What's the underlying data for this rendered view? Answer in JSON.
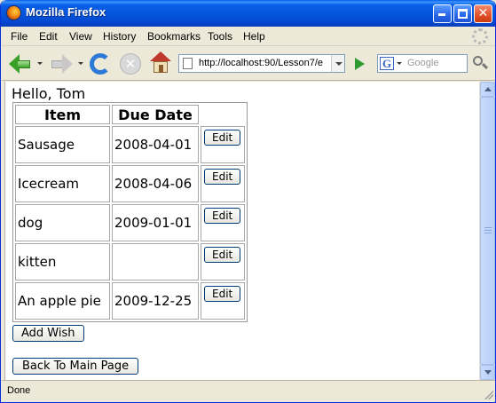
{
  "window": {
    "title": "Mozilla Firefox"
  },
  "menu": [
    "File",
    "Edit",
    "View",
    "History",
    "Bookmarks",
    "Tools",
    "Help"
  ],
  "toolbar": {
    "url": "http://localhost:90/Lesson7/e",
    "search_placeholder": "Google"
  },
  "page": {
    "greeting": "Hello, Tom",
    "table": {
      "headers": [
        "Item",
        "Due Date"
      ],
      "rows": [
        {
          "item": "Sausage",
          "due": "2008-04-01",
          "action": "Edit"
        },
        {
          "item": "Icecream",
          "due": "2008-04-06",
          "action": "Edit"
        },
        {
          "item": "dog",
          "due": "2009-01-01",
          "action": "Edit"
        },
        {
          "item": "kitten",
          "due": "",
          "action": "Edit"
        },
        {
          "item": "An apple pie",
          "due": "2009-12-25",
          "action": "Edit"
        }
      ]
    },
    "add_button": "Add Wish",
    "back_button": "Back To Main Page"
  },
  "status": {
    "text": "Done"
  }
}
